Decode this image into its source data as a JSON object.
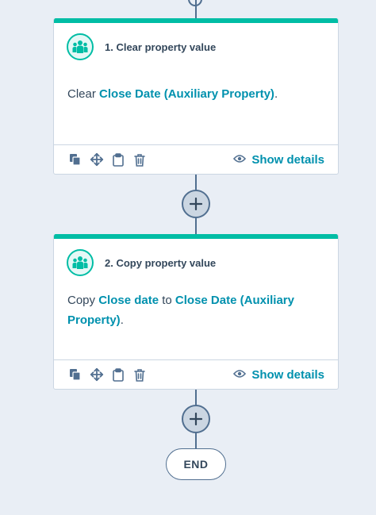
{
  "actions": [
    {
      "title": "1. Clear property value",
      "verb": "Clear",
      "property": "Close Date (Auxiliary Property)",
      "end_punct": ".",
      "show_details": "Show details"
    },
    {
      "title": "2. Copy property value",
      "verb": "Copy",
      "source_property": "Close date",
      "connector_word": "to",
      "target_property_line1": "Close Date (Auxiliary",
      "target_property_line2": "Property)",
      "end_punct": ".",
      "show_details": "Show details"
    }
  ],
  "end_label": "END",
  "icons": {
    "avatar": "people-group-icon",
    "clone": "clone-icon",
    "move": "move-arrows-icon",
    "clipboard": "clipboard-icon",
    "delete": "trash-icon",
    "details": "eye-icon",
    "add": "plus-icon"
  },
  "colors": {
    "accent": "#00bda5",
    "link": "#0091ae",
    "text": "#33475b",
    "connector": "#516f90",
    "background": "#e9eef5"
  }
}
